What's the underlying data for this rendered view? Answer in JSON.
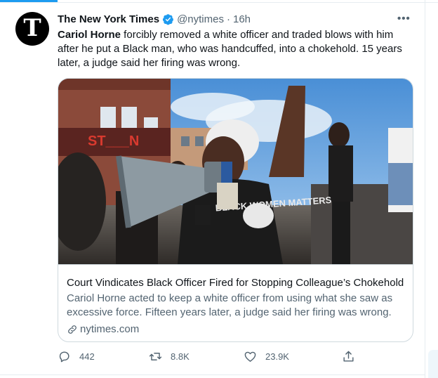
{
  "account": {
    "name": "The New York Times",
    "handle": "@nytimes",
    "time": "16h",
    "verified": true,
    "avatar_letter": "T"
  },
  "tweet": {
    "bold_text": "Cariol Horne",
    "text": " forcibly removed a white officer and traded blows with him after he put a Black man, who was handcuffed, into a chokehold. 15 years later, a judge said her firing was wrong."
  },
  "card": {
    "image_sign_text": "ST___N",
    "shirt_text": "BLACK WOMEN MATTERS",
    "title": "Court Vindicates Black Officer Fired for Stopping Colleague’s Chokehold",
    "description": "Cariol Horne acted to keep a white officer from using what she saw as excessive force. Fifteen years later, a judge said her firing was wrong.",
    "domain": "nytimes.com"
  },
  "actions": {
    "replies": "442",
    "retweets": "8.8K",
    "likes": "23.9K"
  },
  "more_label": "•••",
  "colors": {
    "accent": "#1d9bf0",
    "text_primary": "#0f1419",
    "text_secondary": "#536471",
    "border": "#cfd9de"
  },
  "icons": [
    "verified-badge-icon",
    "more-icon",
    "link-icon",
    "reply-icon",
    "retweet-icon",
    "like-icon",
    "share-icon"
  ]
}
